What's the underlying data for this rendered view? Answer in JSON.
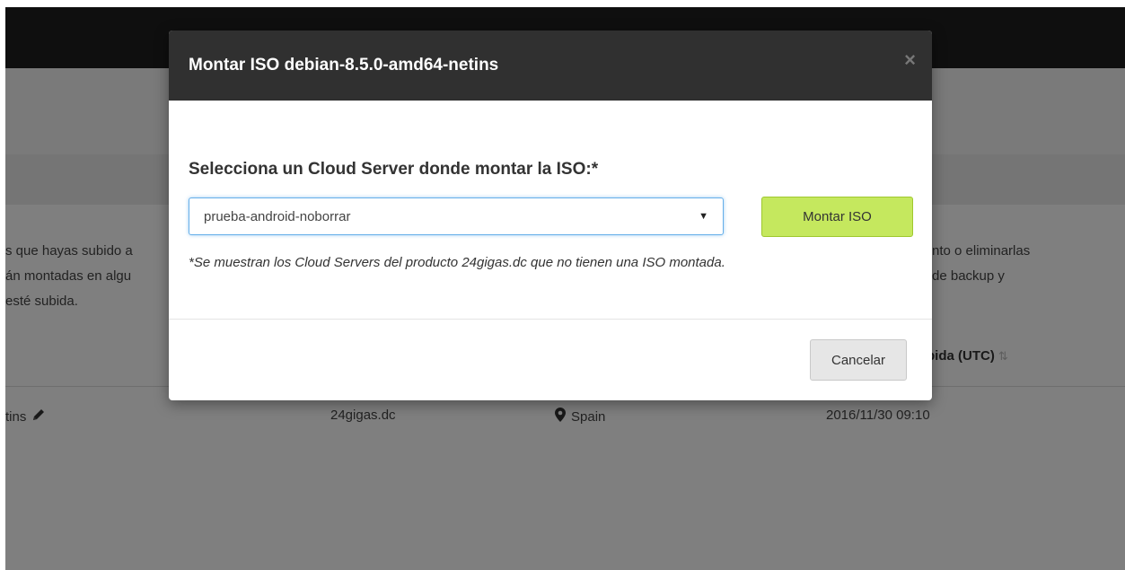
{
  "background": {
    "intro_left_lines": [
      "s que hayas subido a",
      "án montadas en algu",
      "esté subida."
    ],
    "intro_right_lines": [
      "nto o eliminarlas",
      "de backup y"
    ],
    "table_header": {
      "upload_date_label": "bida (UTC)",
      "sort_icon": "sort-icon"
    },
    "table_rows": [
      {
        "name": "tins",
        "product": "24gigas.dc",
        "location": "Spain",
        "uploaded": "2016/11/30 09:10"
      }
    ]
  },
  "modal": {
    "title": "Montar ISO debian-8.5.0-amd64-netins",
    "close_label": "×",
    "label": "Selecciona un Cloud Server donde montar la ISO:*",
    "select": {
      "selected": "prueba-android-noborrar"
    },
    "mount_button": "Montar ISO",
    "hint": "*Se muestran los Cloud Servers del producto 24gigas.dc que no tienen una ISO montada.",
    "cancel_button": "Cancelar"
  },
  "colors": {
    "mount_button_bg": "#c5e85e",
    "header_bg": "#303030",
    "focus_border": "#66afe9"
  }
}
